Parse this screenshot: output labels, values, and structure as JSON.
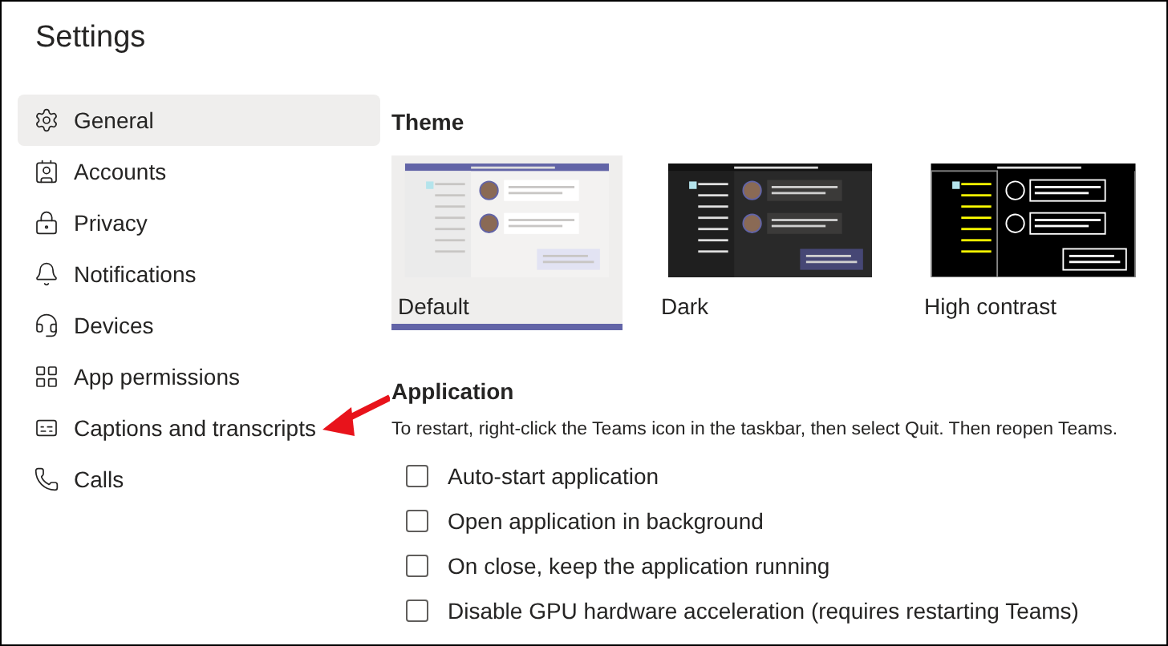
{
  "window": {
    "title": "Settings"
  },
  "sidebar": {
    "items": [
      {
        "label": "General",
        "kind": "gear",
        "selected": true
      },
      {
        "label": "Accounts",
        "kind": "card",
        "selected": false
      },
      {
        "label": "Privacy",
        "kind": "lock",
        "selected": false
      },
      {
        "label": "Notifications",
        "kind": "bell",
        "selected": false
      },
      {
        "label": "Devices",
        "kind": "headset",
        "selected": false
      },
      {
        "label": "App permissions",
        "kind": "apps",
        "selected": false
      },
      {
        "label": "Captions and transcripts",
        "kind": "cc",
        "selected": false
      },
      {
        "label": "Calls",
        "kind": "phone",
        "selected": false
      }
    ]
  },
  "theme": {
    "heading": "Theme",
    "options": [
      {
        "label": "Default",
        "kind": "default",
        "selected": true
      },
      {
        "label": "Dark",
        "kind": "dark",
        "selected": false
      },
      {
        "label": "High contrast",
        "kind": "contrast",
        "selected": false
      }
    ]
  },
  "application": {
    "heading": "Application",
    "note": "To restart, right-click the Teams icon in the taskbar, then select Quit. Then reopen Teams.",
    "options": [
      {
        "label": "Auto-start application",
        "checked": false
      },
      {
        "label": "Open application in background",
        "checked": false
      },
      {
        "label": "On close, keep the application running",
        "checked": false
      },
      {
        "label": "Disable GPU hardware acceleration (requires restarting Teams)",
        "checked": false
      }
    ]
  }
}
